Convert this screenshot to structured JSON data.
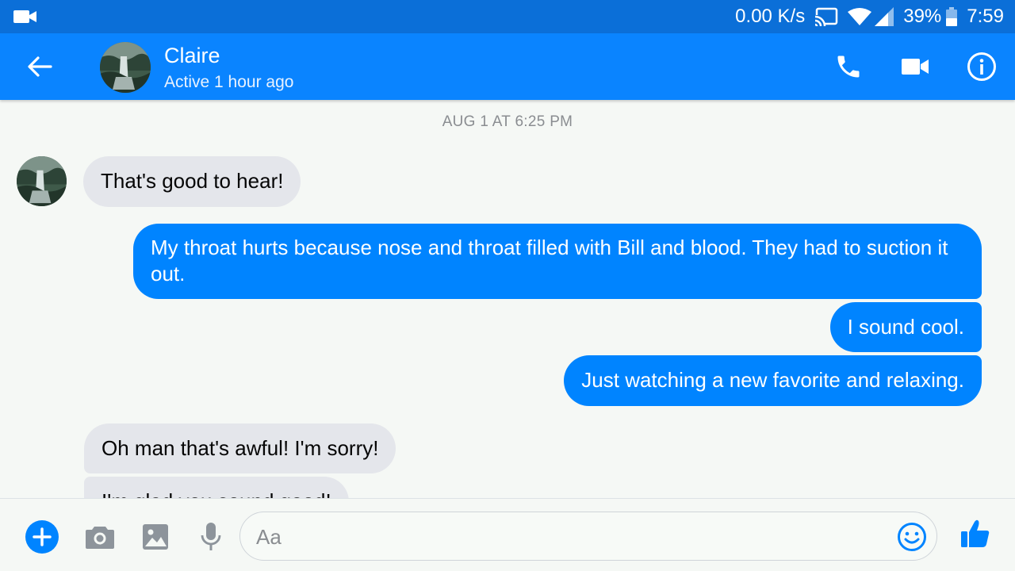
{
  "status_bar": {
    "speed": "0.00 K/s",
    "battery": "39%",
    "time": "7:59"
  },
  "header": {
    "contact_name": "Claire",
    "contact_status": "Active 1 hour ago"
  },
  "conversation": {
    "timestamp": "AUG 1 AT 6:25 PM",
    "messages": [
      {
        "direction": "incoming",
        "text": "That's good to hear!"
      },
      {
        "direction": "outgoing",
        "text": "My throat hurts because nose and throat filled with Bill and blood. They had to suction it out."
      },
      {
        "direction": "outgoing",
        "text": "I sound cool."
      },
      {
        "direction": "outgoing",
        "text": "Just watching a new favorite and relaxing."
      },
      {
        "direction": "incoming",
        "text": "Oh man that's awful! I'm sorry!"
      },
      {
        "direction": "incoming",
        "text": "I'm glad you sound good!"
      }
    ]
  },
  "composer": {
    "placeholder": "Aa"
  },
  "colors": {
    "header_blue": "#0a84ff",
    "status_bar_blue": "#0b6fd8",
    "outgoing_bubble": "#0084ff",
    "incoming_bubble": "#e4e6eb"
  },
  "icons": [
    "video-camera-icon",
    "cast-icon",
    "wifi-icon",
    "signal-icon",
    "battery-icon",
    "back-arrow-icon",
    "phone-icon",
    "video-call-icon",
    "info-icon",
    "plus-icon",
    "camera-icon",
    "gallery-icon",
    "microphone-icon",
    "emoji-icon",
    "thumbs-up-icon"
  ]
}
